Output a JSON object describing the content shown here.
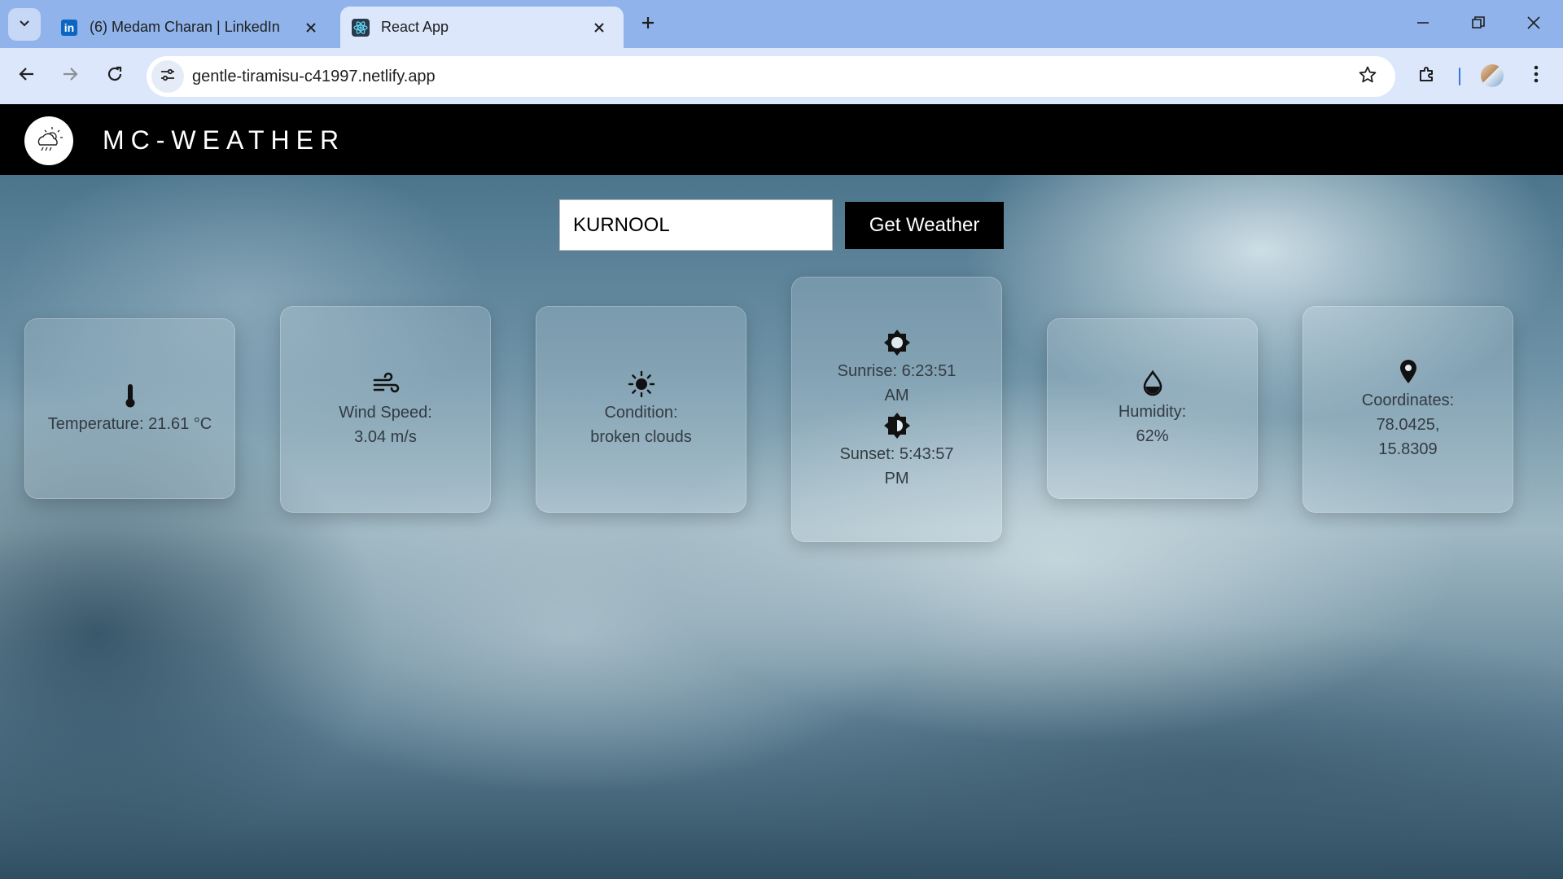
{
  "browser": {
    "tabs": [
      {
        "title": "(6) Medam Charan | LinkedIn",
        "favicon": "linkedin-icon",
        "active": false
      },
      {
        "title": "React App",
        "favicon": "react-icon",
        "active": true
      }
    ],
    "url": "gentle-tiramisu-c41997.netlify.app",
    "favicon_linkedin_letters": "in"
  },
  "app": {
    "brand": "MC-WEATHER",
    "logo_icon": "cloud-sun-rain-icon",
    "search": {
      "value": "KURNOOL",
      "button_label": "Get Weather"
    },
    "cards": {
      "temperature": {
        "icon": "thermometer-icon",
        "text": "Temperature: 21.61 °C"
      },
      "wind": {
        "icon": "wind-icon",
        "text": "Wind Speed: 3.04 m/s"
      },
      "condition": {
        "icon": "sun-icon",
        "text": "Condition: broken clouds"
      },
      "sunrise": {
        "icon": "sunrise-icon",
        "text": "Sunrise: 6:23:51 AM"
      },
      "sunset": {
        "icon": "sunset-icon",
        "text": "Sunset: 5:43:57 PM"
      },
      "humidity": {
        "icon": "droplet-icon",
        "text": "Humidity: 62%"
      },
      "coordinates": {
        "icon": "map-pin-icon",
        "text": "Coordinates: 78.0425, 15.8309"
      }
    }
  },
  "colors": {
    "tabstrip": "#8fb3ea",
    "toolbar": "#dce7fb",
    "header": "#000000",
    "button": "#000000"
  }
}
